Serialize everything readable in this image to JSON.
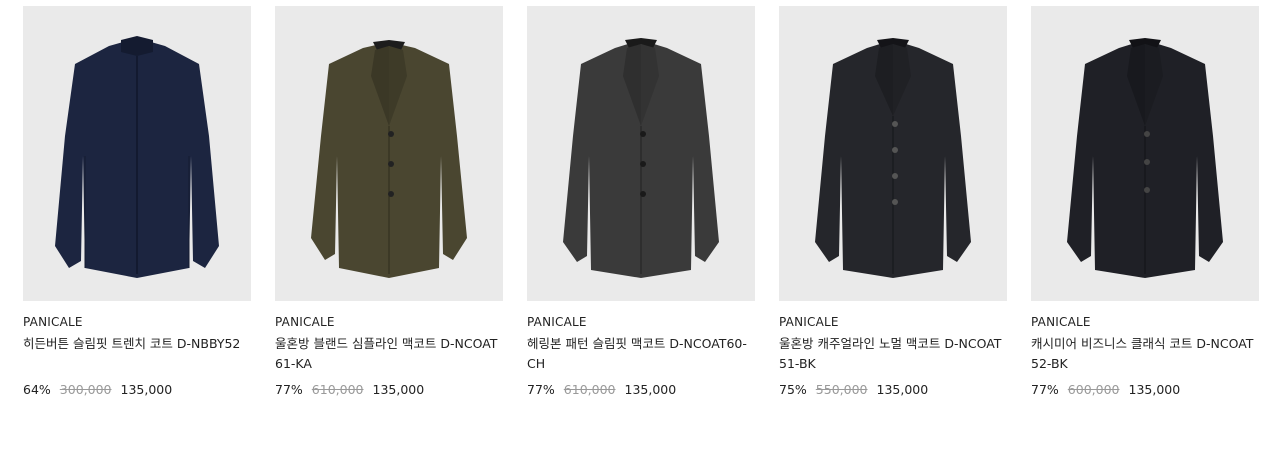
{
  "products": [
    {
      "brand": "PANICALE",
      "name": "히든버튼 슬림핏 트렌치 코트 D-NBBY52",
      "discount": "64%",
      "original_price": "300,000",
      "sale_price": "135,000",
      "coat_color": "#1c2540",
      "collar_style": "stand",
      "buttons": "hidden"
    },
    {
      "brand": "PANICALE",
      "name": "울혼방 블랜드 심플라인 맥코트 D-NCOAT61-KA",
      "discount": "77%",
      "original_price": "610,000",
      "sale_price": "135,000",
      "coat_color": "#4a4630",
      "collar_style": "notch",
      "buttons": "three"
    },
    {
      "brand": "PANICALE",
      "name": "헤링본 패턴 슬림핏 맥코트 D-NCOAT60-CH",
      "discount": "77%",
      "original_price": "610,000",
      "sale_price": "135,000",
      "coat_color": "#3a3a3a",
      "collar_style": "notch",
      "buttons": "three"
    },
    {
      "brand": "PANICALE",
      "name": "울혼방 캐주얼라인 노멀 맥코트 D-NCOAT51-BK",
      "discount": "75%",
      "original_price": "550,000",
      "sale_price": "135,000",
      "coat_color": "#25262b",
      "collar_style": "notch",
      "buttons": "four"
    },
    {
      "brand": "PANICALE",
      "name": "캐시미어 비즈니스 클래식 코트 D-NCOAT52-BK",
      "discount": "77%",
      "original_price": "600,000",
      "sale_price": "135,000",
      "coat_color": "#1f2026",
      "collar_style": "notch",
      "buttons": "three"
    }
  ],
  "colors": {
    "image_background": "#eaeaea",
    "text": "#222222",
    "original_price": "#9a9a9a"
  }
}
